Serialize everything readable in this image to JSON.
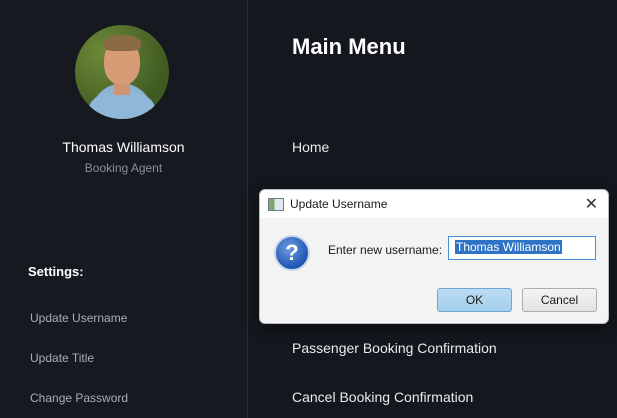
{
  "profile": {
    "name": "Thomas Williamson",
    "role": "Booking Agent"
  },
  "settings": {
    "title": "Settings:",
    "items": [
      "Update Username",
      "Update Title",
      "Change Password"
    ]
  },
  "main": {
    "title": "Main Menu",
    "menu_items": [
      "Home",
      "Passenger Booking Confirmation",
      "Cancel Booking Confirmation"
    ]
  },
  "dialog": {
    "title": "Update Username",
    "label": "Enter new username:",
    "input_value": "Thomas Williamson",
    "ok_label": "OK",
    "cancel_label": "Cancel",
    "close_glyph": "✕",
    "question_glyph": "?"
  }
}
